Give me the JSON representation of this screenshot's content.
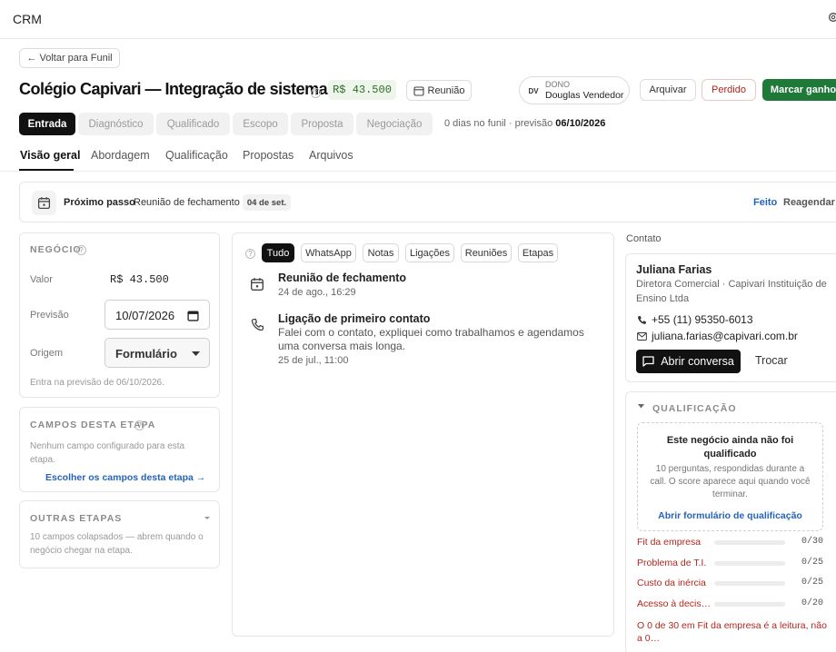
{
  "app": {
    "title": "CRM"
  },
  "header": {
    "back_label": "← Voltar para Funil",
    "deal_title": "Colégio Capivari — Integração de sistemas",
    "amount": "R$ 43.500",
    "meeting_label": "Reunião",
    "owner": {
      "initials": "DV",
      "role": "DONO",
      "name": "Douglas Vendedor"
    },
    "archive_label": "Arquivar",
    "lost_label": "Perdido",
    "won_label": "Marcar ganho"
  },
  "stages": {
    "items": [
      "Entrada",
      "Diagnóstico",
      "Qualificado",
      "Escopo",
      "Proposta",
      "Negociação"
    ],
    "info_prefix": "0 dias no funil · previsão ",
    "info_date": "06/10/2026"
  },
  "tabs": [
    "Visão geral",
    "Abordagem",
    "Qualificação",
    "Propostas",
    "Arquivos"
  ],
  "next_step": {
    "label": "Próximo passo",
    "value": "Reunião de fechamento",
    "date": "04 de set.",
    "done_label": "Feito",
    "reschedule_label": "Reagendar"
  },
  "deal_panel": {
    "title": "NEGÓCIO",
    "value_label": "Valor",
    "value": "R$ 43.500",
    "forecast_label": "Previsão",
    "forecast_value": "10/07/2026",
    "origin_label": "Origem",
    "origin_value": "Formulário",
    "note": "Entra na previsão de 06/10/2026."
  },
  "stage_fields": {
    "title": "CAMPOS DESTA ETAPA",
    "empty_text": "Nenhum campo configurado para esta etapa.",
    "link": "Escolher os campos desta etapa →"
  },
  "other_stages": {
    "title": "OUTRAS ETAPAS",
    "text": "10 campos colapsados — abrem quando o negócio chegar na etapa."
  },
  "activity": {
    "filters": [
      "Tudo",
      "WhatsApp",
      "Notas",
      "Ligações",
      "Reuniões",
      "Etapas"
    ],
    "items": [
      {
        "icon": "calendar-icon",
        "title": "Reunião de fechamento",
        "body": "",
        "date": "24 de ago., 16:29"
      },
      {
        "icon": "phone-icon",
        "title": "Ligação de primeiro contato",
        "body": "Falei com o contato, expliquei como trabalhamos e agendamos uma conversa mais longa.",
        "date": "25 de jul., 11:00"
      }
    ]
  },
  "contact": {
    "section_label": "Contato",
    "name": "Juliana Farias",
    "role_company": "Diretora Comercial · Capivari Instituição de Ensino Ltda",
    "phone": "+55 (11) 95350-6013",
    "email": "juliana.farias@capivari.com.br",
    "open_chat_label": "Abrir conversa",
    "swap_label": "Trocar"
  },
  "qualification": {
    "title": "QUALIFICAÇÃO",
    "box_title": "Este negócio ainda não foi qualificado",
    "box_text": "10 perguntas, respondidas durante a call. O score aparece aqui quando você terminar.",
    "box_link": "Abrir formulário de qualificação",
    "rows": [
      {
        "label": "Fit da empresa",
        "score": "0/30",
        "fill": 0
      },
      {
        "label": "Problema de T.I.",
        "score": "0/25",
        "fill": 0
      },
      {
        "label": "Custo da inércia",
        "score": "0/25",
        "fill": 0
      },
      {
        "label": "Acesso à decis…",
        "score": "0/20",
        "fill": 0
      }
    ],
    "footnote": "O 0 de 30 em Fit da empresa é a leitura, não a 0…"
  },
  "colors": {
    "accent_green": "#1f7a3a",
    "lost_red": "#b3261e",
    "link_blue": "#2563b8"
  }
}
